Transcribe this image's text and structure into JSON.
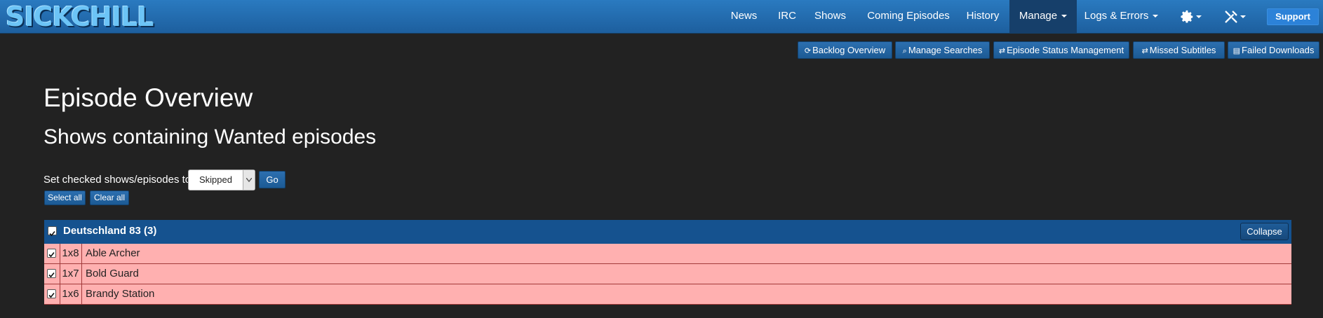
{
  "app": {
    "logo_text": "SICKCHILL"
  },
  "nav": {
    "items": [
      "News",
      "IRC",
      "Shows",
      "Coming Episodes",
      "History"
    ],
    "manage": "Manage",
    "logs": "Logs & Errors",
    "settings_icon": "gear-icon",
    "tools_icon": "tools-icon",
    "support": "Support"
  },
  "submenu": {
    "backlog": "Backlog Overview",
    "manage_searches": "Manage Searches",
    "episode_status": "Episode Status Management",
    "missed_subtitles": "Missed Subtitles",
    "failed_downloads": "Failed Downloads"
  },
  "page": {
    "title": "Episode Overview",
    "subtitle": "Shows containing Wanted episodes",
    "set_label": "Set checked shows/episodes to",
    "status_selected": "Skipped",
    "go": "Go",
    "select_all": "Select all",
    "clear_all": "Clear all"
  },
  "show": {
    "title": "Deutschland 83 (3)",
    "collapse": "Collapse",
    "episodes": [
      {
        "num": "1x8",
        "name": "Able Archer",
        "checked": true
      },
      {
        "num": "1x7",
        "name": "Bold Guard",
        "checked": true
      },
      {
        "num": "1x6",
        "name": "Brandy Station",
        "checked": true
      }
    ]
  },
  "colors": {
    "navbar": "#2a7ac0",
    "background": "#222222",
    "show_header": "#15528f",
    "wanted_row": "#ffb0b0",
    "support_button": "#2c82d8"
  }
}
